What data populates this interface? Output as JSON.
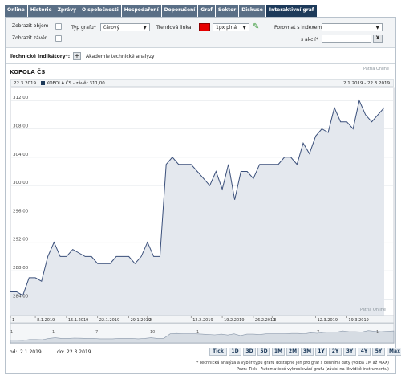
{
  "tabs": [
    "Online",
    "Historie",
    "Zprávy",
    "O společnosti",
    "Hospodaření",
    "Doporučení",
    "Graf",
    "Sektor",
    "Diskuse",
    "Interaktivní graf"
  ],
  "controls": {
    "show_volume": "Zobrazit objem",
    "show_close": "Zobrazit závěr",
    "chart_type_label": "Typ grafu*",
    "chart_type_value": "čárový",
    "trendline_label": "Trendová linka",
    "trend_width_value": "1px plná",
    "compare_label": "Porovnat s indexem*",
    "compare_value": "",
    "or_stock_label": "s akcií*",
    "clear_label": "X"
  },
  "tech": {
    "label": "Technické indikátory*:",
    "add": "+",
    "academy": "Akademie technické analýzy"
  },
  "header": {
    "title": "KOFOLA ČS",
    "source_top": "Patria Online",
    "date_left": "22.3.2019",
    "series_legend": "KOFOLA ČS - závěr 311,00",
    "date_range": "2.1.2019 - 22.3.2019",
    "source_bottom": "Patria Online"
  },
  "chart_data": {
    "type": "area",
    "title": "KOFOLA ČS",
    "ylim": [
      282,
      313.5
    ],
    "yticks": [
      "284,00",
      "288,00",
      "292,00",
      "296,00",
      "300,00",
      "304,00",
      "308,00",
      "312,00"
    ],
    "ytick_values": [
      284,
      288,
      292,
      296,
      300,
      304,
      308,
      312
    ],
    "xticks": [
      "1",
      "8.1.2019",
      "15.1.2019",
      "22.1.2019",
      "29.1.2019",
      "2",
      "12.2.2019",
      "19.2.2019",
      "26.2.2019",
      "3",
      "12.3.2019",
      "19.3.2019"
    ],
    "xtick_index": [
      0,
      4,
      9,
      14,
      19,
      22,
      29,
      34,
      39,
      42,
      49,
      54
    ],
    "series": [
      {
        "values": [
          285,
          285,
          284.5,
          287,
          287,
          286.5,
          290,
          292,
          290,
          290,
          291,
          290.5,
          290,
          290,
          289,
          289,
          289,
          290,
          290,
          290,
          289,
          290,
          292,
          290,
          290,
          303,
          304,
          303,
          303,
          303,
          302,
          301,
          300,
          302,
          299.5,
          303,
          298,
          302,
          302,
          301,
          303,
          303,
          303,
          303,
          304,
          304,
          303,
          306,
          304.5,
          307,
          308,
          307.5,
          311,
          309,
          309,
          308,
          312,
          310,
          309,
          310,
          311
        ]
      }
    ]
  },
  "navigator": {
    "labels": [
      "1",
      "1",
      "7",
      "10",
      "1",
      "7",
      "1"
    ]
  },
  "footer": {
    "from_label": "od:",
    "from_value": "2.1.2019",
    "to_label": "do:",
    "to_value": "22.3.2019",
    "periods": [
      "Tick",
      "1D",
      "3D",
      "5D",
      "1M",
      "2M",
      "3M",
      "1Y",
      "2Y",
      "3Y",
      "4Y",
      "5Y",
      "Max"
    ],
    "note1": "* Technická analýza a výběr typu grafu dostupné jen pro graf s denními daty (volba 1M až MAX)",
    "note2": "Pozn: Tick - Automatické vykreslování grafu (závisí na likviditě instrumentu)"
  },
  "colors": {
    "line": "#3a4f7a",
    "fill": "#e4e8ee",
    "tab": "#5a6f86",
    "tab_active": "#1d3a5a"
  }
}
